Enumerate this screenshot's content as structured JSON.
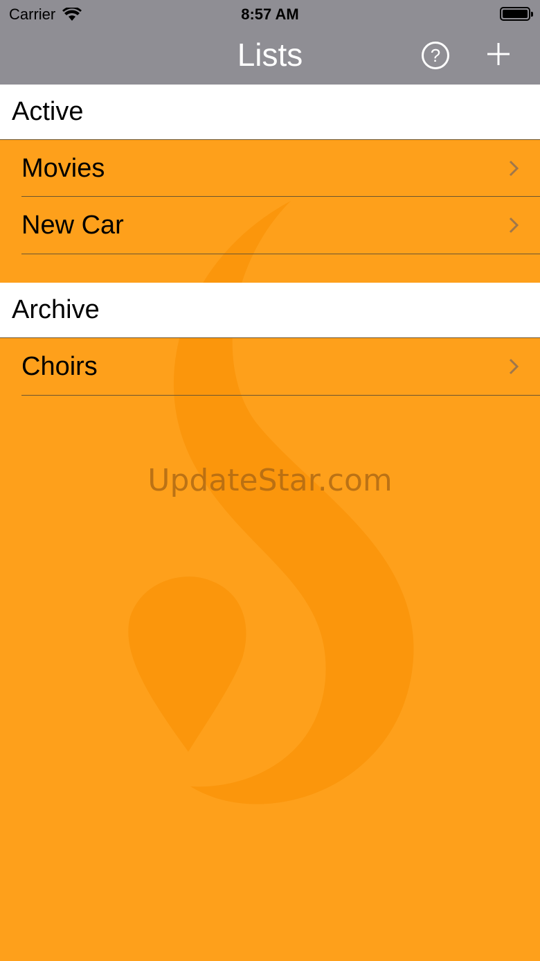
{
  "status_bar": {
    "carrier": "Carrier",
    "time": "8:57 AM"
  },
  "nav": {
    "title": "Lists",
    "help_label": "?"
  },
  "sections": [
    {
      "title": "Active",
      "rows": [
        {
          "label": "Movies"
        },
        {
          "label": "New Car"
        }
      ]
    },
    {
      "title": "Archive",
      "rows": [
        {
          "label": "Choirs"
        }
      ]
    }
  ],
  "watermark": {
    "text": "UpdateStar.com"
  },
  "colors": {
    "nav_bg": "#8f8e94",
    "background": "#fea01b",
    "header_bg": "#ffffff"
  }
}
